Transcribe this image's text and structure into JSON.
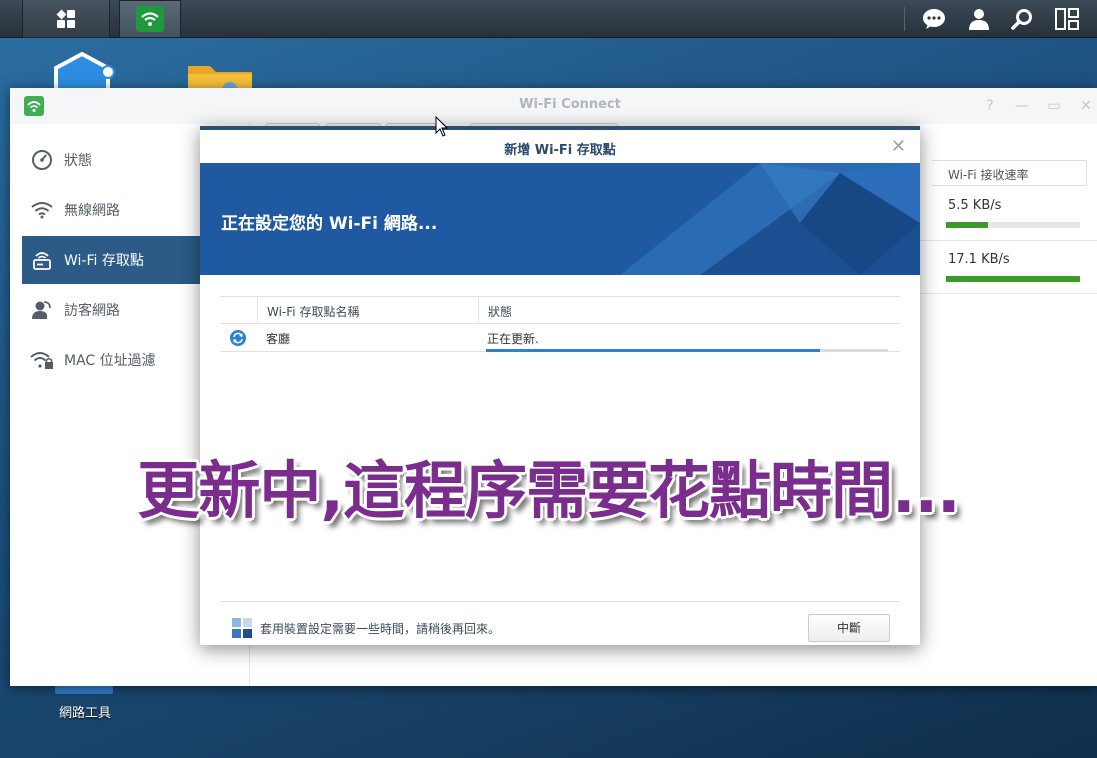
{
  "window": {
    "title": "Wi-Fi Connect"
  },
  "sidebar": {
    "items": [
      {
        "label": "狀態",
        "icon": "gauge-icon"
      },
      {
        "label": "無線網路",
        "icon": "wifi-icon"
      },
      {
        "label": "Wi-Fi 存取點",
        "icon": "access-point-icon",
        "active": true
      },
      {
        "label": "訪客網路",
        "icon": "guest-icon"
      },
      {
        "label": "MAC 位址過濾",
        "icon": "wifi-lock-icon"
      }
    ]
  },
  "background_table": {
    "rate_header": "Wi-Fi 接收速率",
    "rows": [
      {
        "rate": "5.5 KB/s",
        "level": 0.31
      },
      {
        "rate": "17.1 KB/s",
        "level": 1.0
      }
    ]
  },
  "dialog": {
    "title": "新增 Wi-Fi 存取點",
    "banner_text": "正在設定您的 Wi-Fi 網路...",
    "columns": [
      "Wi-Fi 存取點名稱",
      "狀態"
    ],
    "row": {
      "name": "客廳",
      "status": "正在更新.",
      "progress": 0.83
    },
    "footer_text": "套用裝置設定需要一些時間，請稍後再回來。",
    "stop_button": "中斷"
  },
  "desktop": {
    "icon_label": "網路工具"
  },
  "overlay_caption": "更新中,這程序需要花點時間...",
  "colors": {
    "accent": "#2c5b88",
    "banner": "#1f5aa3",
    "overlay": "#7a2d8c",
    "rate_bar": "#3e9a2c",
    "progress": "#2f7fd0"
  }
}
